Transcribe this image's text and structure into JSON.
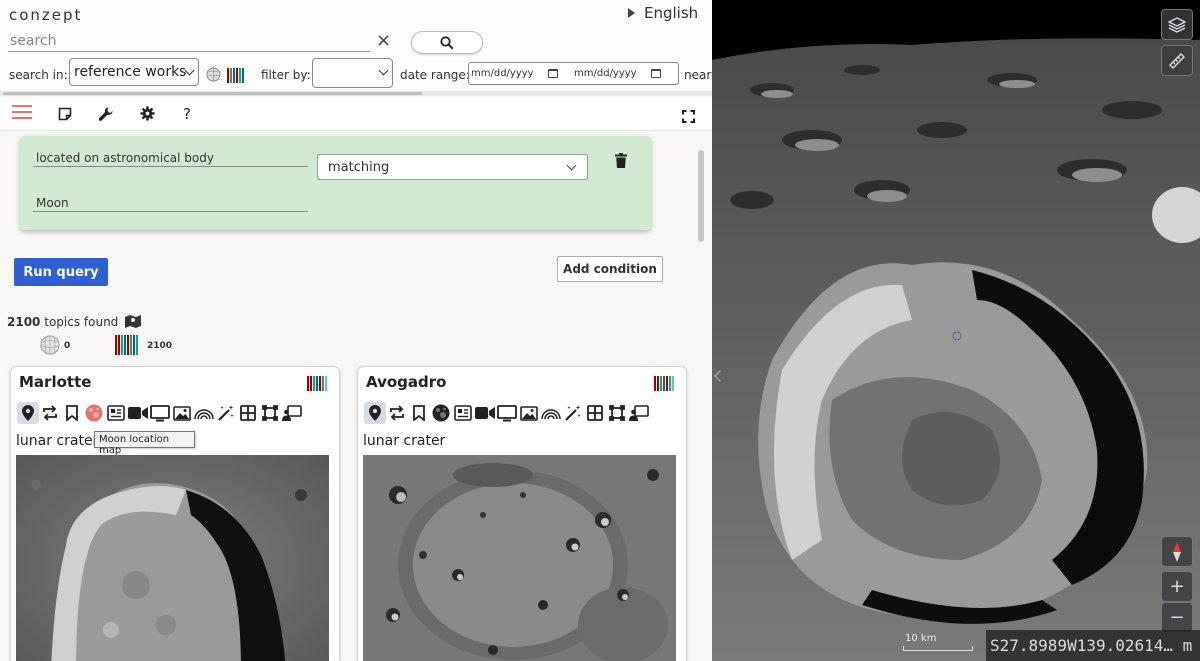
{
  "header": {
    "logo": "conzept",
    "language": "English",
    "search_placeholder": "search",
    "search_value": "",
    "clear_label": "×",
    "search_in_label": "search in:",
    "search_in_value": "reference works",
    "filter_by_label": "filter by:",
    "filter_by_value": "",
    "date_range_label": "date range:",
    "date_start_placeholder": "mm/dd/yyyy",
    "date_end_placeholder": "mm/dd/yyyy",
    "near_label": "near"
  },
  "toolbar": {
    "icons": [
      "menu-icon",
      "sticky-note-icon",
      "wrench-icon",
      "gear-icon",
      "help-icon",
      "fullscreen-icon"
    ],
    "help_label": "?"
  },
  "query": {
    "property_value": "located on astronomical body",
    "operator_value": "matching",
    "object_value": "Moon",
    "run_label": "Run query",
    "add_condition_label": "Add condition"
  },
  "results": {
    "count": "2100",
    "count_suffix": "topics found",
    "wikipedia_count": "0",
    "wikidata_count": "2100"
  },
  "cards": [
    {
      "title": "Marlotte",
      "subtitle": "lunar crater"
    },
    {
      "title": "Avogadro",
      "subtitle": "lunar crater"
    }
  ],
  "tooltip": "Moon location map",
  "globe": {
    "scale_label": "10 km",
    "coordinates": "S27.8989W139.02614… m",
    "zoom_in_label": "+",
    "zoom_out_label": "−"
  },
  "colors": {
    "accent_blue": "#2f5fd0",
    "condition_bg": "#d2ead2",
    "menu_icon": "#e57373"
  }
}
